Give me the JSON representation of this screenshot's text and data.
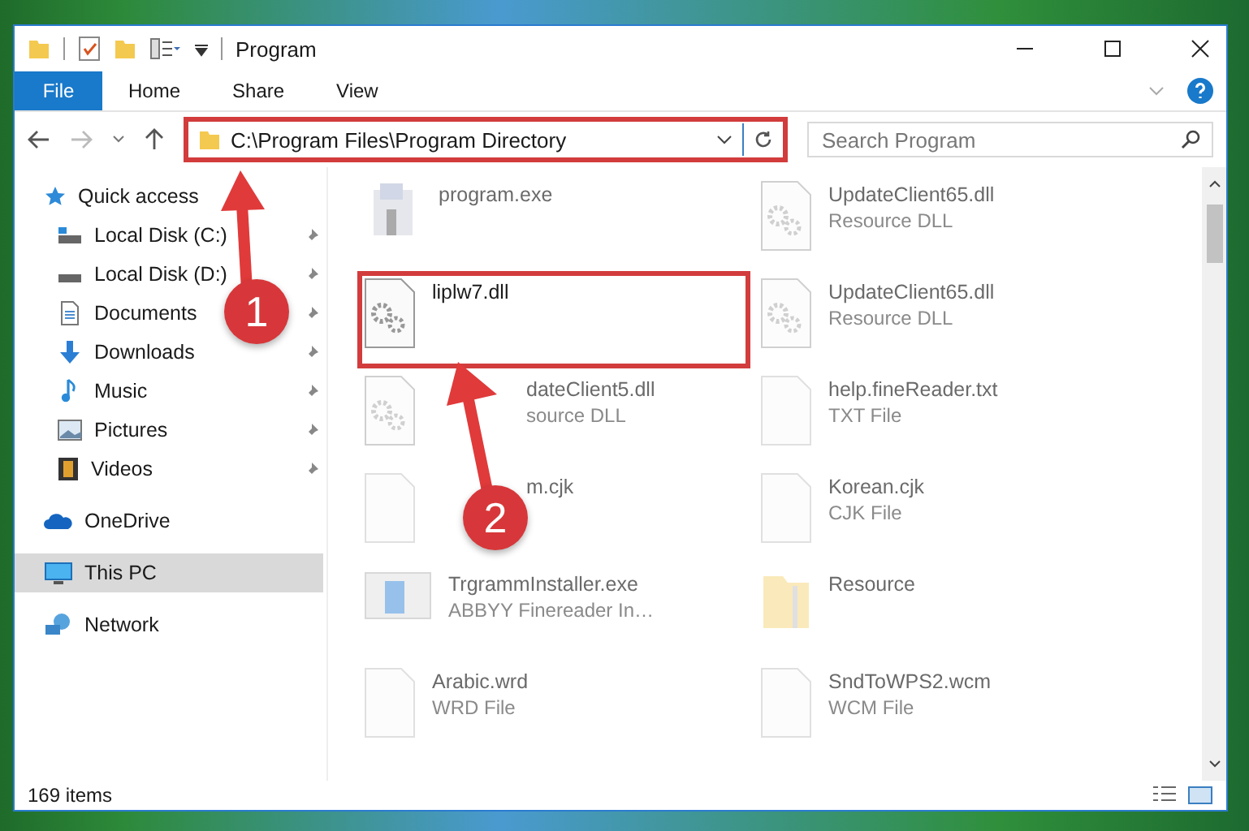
{
  "window": {
    "title": "Program"
  },
  "ribbon": {
    "tabs": [
      {
        "label": "File",
        "kind": "file"
      },
      {
        "label": "Home",
        "kind": "tab"
      },
      {
        "label": "Share",
        "kind": "tab"
      },
      {
        "label": "View",
        "kind": "tab"
      }
    ]
  },
  "address_bar": {
    "path": "C:\\Program Files\\Program Directory"
  },
  "search": {
    "placeholder": "Search Program"
  },
  "sidebar": {
    "items": [
      {
        "label": "Quick access",
        "selected": false,
        "children": [
          {
            "label": "Local Disk (C:)",
            "pinned": true,
            "selected": false
          },
          {
            "label": "Local Disk (D:)",
            "pinned": true,
            "selected": false
          },
          {
            "label": "Documents",
            "pinned": true,
            "selected": false
          },
          {
            "label": "Downloads",
            "pinned": true,
            "selected": false
          },
          {
            "label": "Music",
            "pinned": true,
            "selected": false
          },
          {
            "label": "Pictures",
            "pinned": true,
            "selected": false
          },
          {
            "label": "Videos",
            "pinned": true,
            "selected": false
          }
        ]
      },
      {
        "label": "OneDrive",
        "selected": false
      },
      {
        "label": "This PC",
        "selected": true
      },
      {
        "label": "Network",
        "selected": false
      }
    ]
  },
  "files": [
    {
      "name": "program.exe",
      "kind": "exe",
      "dimmed": true
    },
    {
      "name": "UpdateClient65.dll",
      "type": "Resource DLL",
      "kind": "dll",
      "dimmed": true
    },
    {
      "name": "liplw7.dll",
      "kind": "dll",
      "dimmed": false,
      "highlighted": true
    },
    {
      "name": "UpdateClient65.dll",
      "type": "Resource DLL",
      "kind": "dll",
      "dimmed": true
    },
    {
      "name": "dateClient5.dll",
      "type": "source DLL",
      "kind": "dll",
      "dimmed": true,
      "covered": true
    },
    {
      "name": "help.fineReader.txt",
      "type": "TXT File",
      "kind": "file",
      "dimmed": true
    },
    {
      "name": "m.cjk",
      "kind": "file",
      "dimmed": true,
      "covered": true
    },
    {
      "name": "Korean.cjk",
      "type": "CJK File",
      "kind": "file",
      "dimmed": true
    },
    {
      "name": "TrgrammInstaller.exe",
      "type": "ABBYY Finereader In…",
      "kind": "installer",
      "dimmed": true
    },
    {
      "name": "Resource",
      "kind": "folder",
      "dimmed": true
    },
    {
      "name": "Arabic.wrd",
      "type": "WRD File",
      "kind": "file",
      "dimmed": true
    },
    {
      "name": "SndToWPS2.wcm",
      "type": "WCM File",
      "kind": "file",
      "dimmed": true
    }
  ],
  "status_bar": {
    "item_count": "169 items"
  },
  "annotations": [
    {
      "number": "1"
    },
    {
      "number": "2"
    }
  ]
}
